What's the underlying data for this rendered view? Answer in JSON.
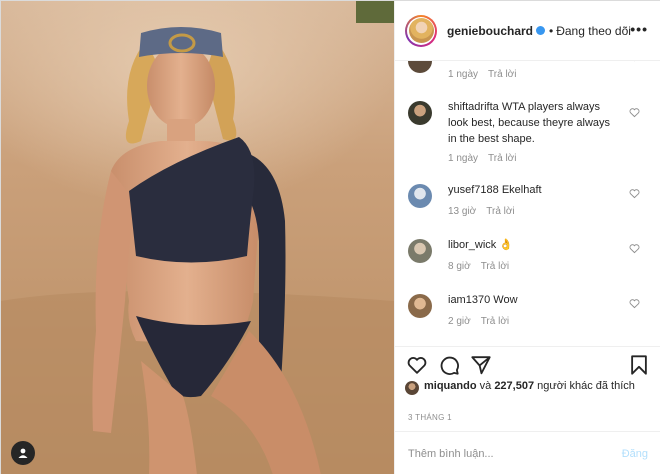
{
  "header": {
    "username": "geniebouchard",
    "separator": "•",
    "follow_state": "Đang theo dõi",
    "more": "•••"
  },
  "comments": [
    {
      "username": "",
      "text": "",
      "time": "1 ngày",
      "reply": "Trả lời",
      "avatar_color": "#5c4a3a"
    },
    {
      "username": "shiftadrifta",
      "text": "WTA players always look best, because theyre always in the best shape.",
      "time": "1 ngày",
      "reply": "Trả lời",
      "avatar_color": "#3a3a2e"
    },
    {
      "username": "yusef7188",
      "text": "Ekelhaft",
      "time": "13 giờ",
      "reply": "Trả lời",
      "avatar_color": "#6b8ab0"
    },
    {
      "username": "libor_wick",
      "text": "👌",
      "time": "8 giờ",
      "reply": "Trả lời",
      "avatar_color": "#7a7a6a"
    },
    {
      "username": "iam1370",
      "text": "Wow",
      "time": "2 giờ",
      "reply": "Trả lời",
      "avatar_color": "#8a6a4a"
    }
  ],
  "likes": {
    "first_user": "miquando",
    "connector": "và",
    "count": "227,507",
    "suffix": "người khác đã thích"
  },
  "date": "3 THÁNG 1",
  "add_comment": {
    "placeholder": "Thêm bình luận...",
    "post_label": "Đăng"
  },
  "colors": {
    "link_blue": "#3897f0",
    "post_disabled": "#b2dffc",
    "meta_gray": "#8e8e8e",
    "sand": "#c9a57e"
  },
  "icons": [
    "like-icon",
    "comment-icon",
    "share-icon",
    "save-icon",
    "user-tag-icon",
    "heart-outline-icon"
  ]
}
